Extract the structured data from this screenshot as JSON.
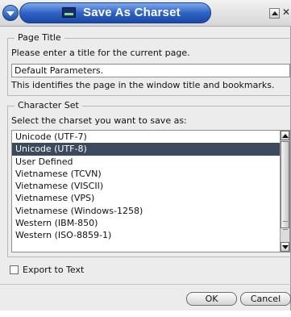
{
  "window": {
    "title": "Save As Charset"
  },
  "page_title_group": {
    "legend": "Page Title",
    "prompt": "Please enter a title for the current page.",
    "field_value": "Default Parameters.",
    "hint": "This identifies the page in the window title and bookmarks."
  },
  "charset_group": {
    "legend": "Character Set",
    "prompt": "Select the charset you want to save as:",
    "items": [
      "Unicode (UTF-7)",
      "Unicode (UTF-8)",
      "User Defined",
      "Vietnamese (TCVN)",
      "Vietnamese (VISCII)",
      "Vietnamese (VPS)",
      "Vietnamese (Windows-1258)",
      "Western (IBM-850)",
      "Western (ISO-8859-1)"
    ],
    "selected": "Unicode (UTF-8)"
  },
  "export_to_text": {
    "label": "Export to Text",
    "checked": false
  },
  "buttons": {
    "ok": "OK",
    "cancel": "Cancel"
  },
  "colors": {
    "title_bar_accent": "#2f63c4",
    "selection": "#3c4a5e"
  }
}
